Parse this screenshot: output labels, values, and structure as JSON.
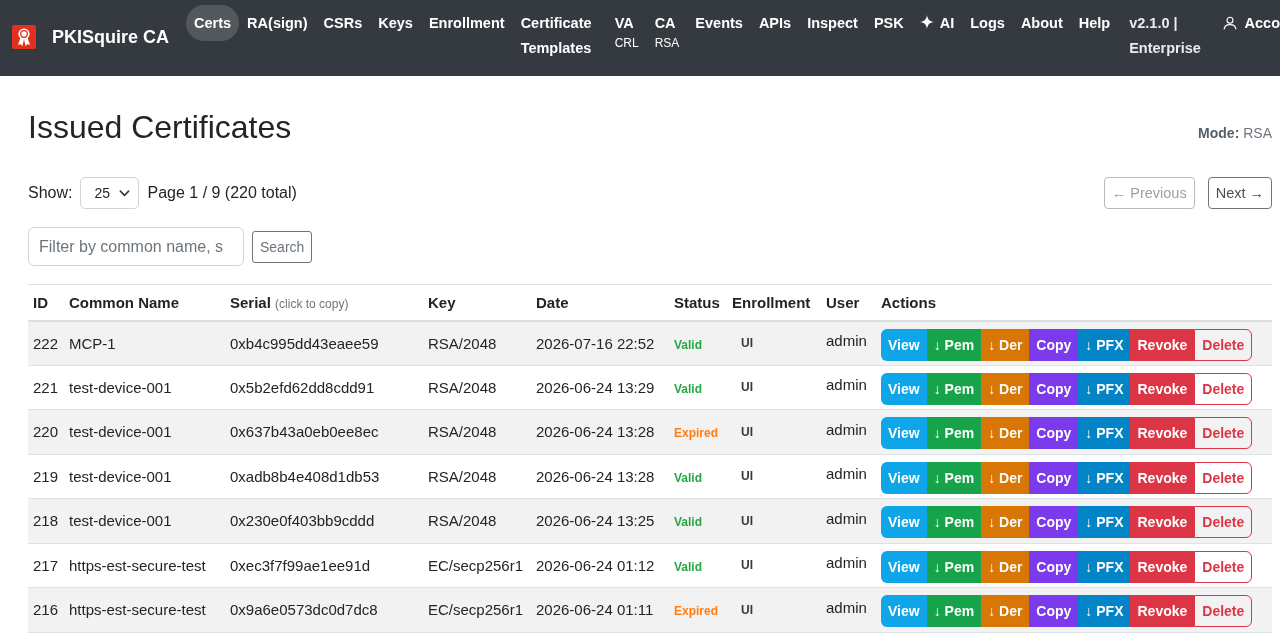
{
  "navbar": {
    "brand": "PKISquire CA",
    "items": [
      {
        "label": "Certs",
        "kind": "link",
        "selected": true
      },
      {
        "label": "RA(sign)",
        "kind": "link",
        "selected": false
      },
      {
        "label": "CSRs",
        "kind": "link",
        "selected": false
      },
      {
        "label": "Keys",
        "kind": "link",
        "selected": false
      },
      {
        "label": "Enrollment",
        "kind": "link",
        "selected": false
      },
      {
        "label": "Certificate Templates",
        "kind": "link",
        "selected": false
      },
      {
        "label": "VA",
        "sublabel": "CRL",
        "kind": "link",
        "selected": false
      },
      {
        "label": "CA",
        "sublabel": "RSA",
        "kind": "link",
        "selected": false
      },
      {
        "label": "Events",
        "kind": "link",
        "selected": false
      },
      {
        "label": "APIs",
        "kind": "link",
        "selected": false
      },
      {
        "label": "Inspect",
        "kind": "link",
        "selected": false
      },
      {
        "label": "PSK",
        "kind": "link",
        "selected": false
      },
      {
        "label": "AI",
        "kind": "icon_link",
        "selected": false
      },
      {
        "label": "Logs",
        "kind": "link",
        "selected": false
      },
      {
        "label": "About",
        "kind": "link",
        "selected": false
      },
      {
        "label": "Help",
        "kind": "link",
        "selected": false
      }
    ],
    "version": "v2.1.0 | Enterprise",
    "account": "Acco"
  },
  "page": {
    "title": "Issued Certificates",
    "mode": "**Mode:** RSA"
  },
  "pagination": {
    "show_label": "Show:",
    "page_size": "25",
    "page_info": "Page 1 / 9 (220 total)",
    "previous": {
      "label": "← Previous",
      "disabled": true
    },
    "next": {
      "label": "Next →",
      "disabled": false
    }
  },
  "filter": {
    "placeholder": "Filter by common name, s",
    "button": "Search"
  },
  "table": {
    "columns": [
      {
        "label": "ID"
      },
      {
        "label": "Common Name"
      },
      {
        "label": "Serial",
        "note": "(click to copy)"
      },
      {
        "label": "Key"
      },
      {
        "label": "Date"
      },
      {
        "label": "Status"
      },
      {
        "label": "Enrollment"
      },
      {
        "label": "User"
      },
      {
        "label": "Actions"
      }
    ],
    "rows": [
      {
        "id": "222",
        "common_name": "MCP-1",
        "serial": "0xb4c995dd43eaee59",
        "key": "RSA/2048",
        "date": "2026-07-16 22:52",
        "status": {
          "label": "Valid",
          "color": "#28a745"
        },
        "enrollment": "UI",
        "user": "admin",
        "actions": [
          {
            "label": "View",
            "kind": "view"
          },
          {
            "label": "↓ Pem",
            "kind": "pem"
          },
          {
            "label": "↓ Der",
            "kind": "der"
          },
          {
            "label": "Copy",
            "kind": "copy"
          },
          {
            "label": "↓ PFX",
            "kind": "pfx"
          },
          {
            "label": "Revoke",
            "kind": "revoke"
          },
          {
            "label": "Delete",
            "kind": "delete"
          }
        ]
      },
      {
        "id": "221",
        "common_name": "test-device-001",
        "serial": "0x5b2efd62dd8cdd91",
        "key": "RSA/2048",
        "date": "2026-06-24 13:29",
        "status": {
          "label": "Valid",
          "color": "#28a745"
        },
        "enrollment": "UI",
        "user": "admin",
        "actions": [
          {
            "label": "View",
            "kind": "view"
          },
          {
            "label": "↓ Pem",
            "kind": "pem"
          },
          {
            "label": "↓ Der",
            "kind": "der"
          },
          {
            "label": "Copy",
            "kind": "copy"
          },
          {
            "label": "↓ PFX",
            "kind": "pfx"
          },
          {
            "label": "Revoke",
            "kind": "revoke"
          },
          {
            "label": "Delete",
            "kind": "delete"
          }
        ]
      },
      {
        "id": "220",
        "common_name": "test-device-001",
        "serial": "0x637b43a0eb0ee8ec",
        "key": "RSA/2048",
        "date": "2026-06-24 13:28",
        "status": {
          "label": "Expired",
          "color": "#fd7e14"
        },
        "enrollment": "UI",
        "user": "admin",
        "actions": [
          {
            "label": "View",
            "kind": "view"
          },
          {
            "label": "↓ Pem",
            "kind": "pem"
          },
          {
            "label": "↓ Der",
            "kind": "der"
          },
          {
            "label": "Copy",
            "kind": "copy"
          },
          {
            "label": "↓ PFX",
            "kind": "pfx"
          },
          {
            "label": "Revoke",
            "kind": "revoke"
          },
          {
            "label": "Delete",
            "kind": "delete"
          }
        ]
      },
      {
        "id": "219",
        "common_name": "test-device-001",
        "serial": "0xadb8b4e408d1db53",
        "key": "RSA/2048",
        "date": "2026-06-24 13:28",
        "status": {
          "label": "Valid",
          "color": "#28a745"
        },
        "enrollment": "UI",
        "user": "admin",
        "actions": [
          {
            "label": "View",
            "kind": "view"
          },
          {
            "label": "↓ Pem",
            "kind": "pem"
          },
          {
            "label": "↓ Der",
            "kind": "der"
          },
          {
            "label": "Copy",
            "kind": "copy"
          },
          {
            "label": "↓ PFX",
            "kind": "pfx"
          },
          {
            "label": "Revoke",
            "kind": "revoke"
          },
          {
            "label": "Delete",
            "kind": "delete"
          }
        ]
      },
      {
        "id": "218",
        "common_name": "test-device-001",
        "serial": "0x230e0f403bb9cddd",
        "key": "RSA/2048",
        "date": "2026-06-24 13:25",
        "status": {
          "label": "Valid",
          "color": "#28a745"
        },
        "enrollment": "UI",
        "user": "admin",
        "actions": [
          {
            "label": "View",
            "kind": "view"
          },
          {
            "label": "↓ Pem",
            "kind": "pem"
          },
          {
            "label": "↓ Der",
            "kind": "der"
          },
          {
            "label": "Copy",
            "kind": "copy"
          },
          {
            "label": "↓ PFX",
            "kind": "pfx"
          },
          {
            "label": "Revoke",
            "kind": "revoke"
          },
          {
            "label": "Delete",
            "kind": "delete"
          }
        ]
      },
      {
        "id": "217",
        "common_name": "https-est-secure-test",
        "serial": "0xec3f7f99ae1ee91d",
        "key": "EC/secp256r1",
        "date": "2026-06-24 01:12",
        "status": {
          "label": "Valid",
          "color": "#28a745"
        },
        "enrollment": "UI",
        "user": "admin",
        "actions": [
          {
            "label": "View",
            "kind": "view"
          },
          {
            "label": "↓ Pem",
            "kind": "pem"
          },
          {
            "label": "↓ Der",
            "kind": "der"
          },
          {
            "label": "Copy",
            "kind": "copy"
          },
          {
            "label": "↓ PFX",
            "kind": "pfx"
          },
          {
            "label": "Revoke",
            "kind": "revoke"
          },
          {
            "label": "Delete",
            "kind": "delete"
          }
        ]
      },
      {
        "id": "216",
        "common_name": "https-est-secure-test",
        "serial": "0x9a6e0573dc0d7dc8",
        "key": "EC/secp256r1",
        "date": "2026-06-24 01:11",
        "status": {
          "label": "Expired",
          "color": "#fd7e14"
        },
        "enrollment": "UI",
        "user": "admin",
        "actions": [
          {
            "label": "View",
            "kind": "view"
          },
          {
            "label": "↓ Pem",
            "kind": "pem"
          },
          {
            "label": "↓ Der",
            "kind": "der"
          },
          {
            "label": "Copy",
            "kind": "copy"
          },
          {
            "label": "↓ PFX",
            "kind": "pfx"
          },
          {
            "label": "Revoke",
            "kind": "revoke"
          },
          {
            "label": "Delete",
            "kind": "delete"
          }
        ]
      }
    ]
  }
}
